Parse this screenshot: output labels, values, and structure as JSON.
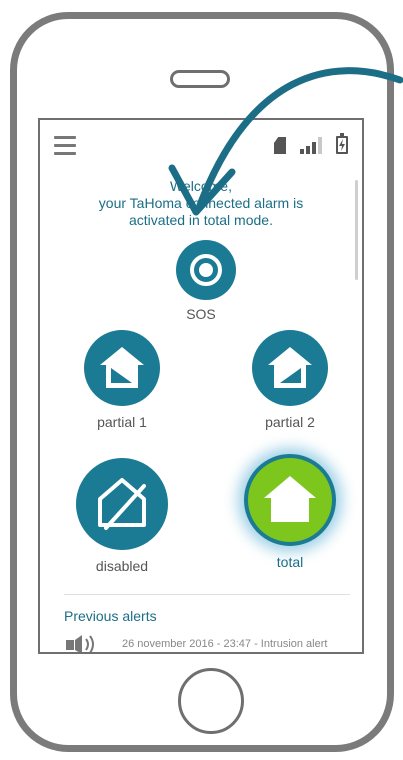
{
  "welcome": {
    "line1": "Welcome,",
    "line2": "your TaHoma connected alarm is",
    "line3": "activated in total mode."
  },
  "sos": {
    "label": "SOS"
  },
  "modes": {
    "partial1": "partial 1",
    "partial2": "partial 2",
    "disabled": "disabled",
    "total": "total"
  },
  "alerts": {
    "heading": "Previous alerts",
    "items": [
      {
        "text": "26 november 2016 - 23:47 - Intrusion alert"
      }
    ]
  },
  "colors": {
    "accent": "#1b7b94",
    "active": "#7cc61d",
    "text_primary": "#1b6e86"
  },
  "icons": {
    "menu": "hamburger-menu-icon",
    "sim": "sim-card-icon",
    "signal": "signal-strength-icon",
    "battery": "battery-charging-icon",
    "sos": "target-icon",
    "partial1": "house-partial-icon",
    "partial2": "house-partial-icon",
    "disabled": "house-crossed-icon",
    "total": "house-icon",
    "alert": "siren-icon"
  }
}
